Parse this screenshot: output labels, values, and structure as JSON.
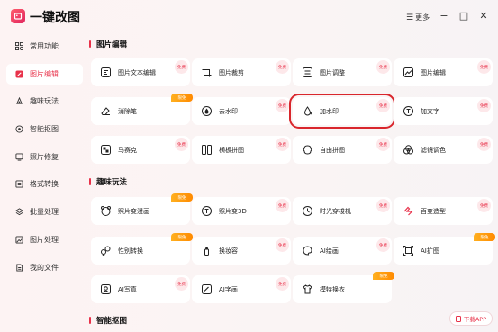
{
  "app": {
    "title": "一键改图",
    "more_label": "更多"
  },
  "window": {
    "minimize": "−",
    "maximize": "□",
    "close": "✕"
  },
  "colors": {
    "accent": "#e8324a",
    "highlight": "#d9262c",
    "vip": "#ff9a10"
  },
  "sidebar": {
    "items": [
      {
        "label": "常用功能",
        "icon": "grid-icon",
        "active": false
      },
      {
        "label": "图片编辑",
        "icon": "edit-image-icon",
        "active": true
      },
      {
        "label": "趣味玩法",
        "icon": "fun-icon",
        "active": false
      },
      {
        "label": "智能抠图",
        "icon": "cutout-icon",
        "active": false
      },
      {
        "label": "照片修复",
        "icon": "repair-icon",
        "active": false
      },
      {
        "label": "格式转换",
        "icon": "convert-icon",
        "active": false
      },
      {
        "label": "批量处理",
        "icon": "batch-icon",
        "active": false
      },
      {
        "label": "图片处理",
        "icon": "image-process-icon",
        "active": false
      },
      {
        "label": "我的文件",
        "icon": "file-icon",
        "active": false
      }
    ]
  },
  "badges": {
    "free": "免费",
    "vip": "限免"
  },
  "sections": [
    {
      "title": "图片编辑"
    },
    {
      "title": "趣味玩法"
    },
    {
      "title": "智能抠图"
    }
  ],
  "cards": [
    {
      "label": "图片文本编辑",
      "icon": "text-edit-icon",
      "badge": "free"
    },
    {
      "label": "图片裁剪",
      "icon": "crop-icon",
      "badge": "free"
    },
    {
      "label": "图片调整",
      "icon": "adjust-icon",
      "badge": "free"
    },
    {
      "label": "图片编辑",
      "icon": "image-edit-icon",
      "badge": "free"
    },
    {
      "label": "消除笔",
      "icon": "eraser-icon",
      "badge": "vip"
    },
    {
      "label": "去水印",
      "icon": "remove-watermark-icon",
      "badge": "free"
    },
    {
      "label": "加水印",
      "icon": "add-watermark-icon",
      "badge": "free"
    },
    {
      "label": "加文字",
      "icon": "add-text-icon",
      "badge": "free"
    },
    {
      "label": "马赛克",
      "icon": "mosaic-icon",
      "badge": "free"
    },
    {
      "label": "横板拼图",
      "icon": "horizontal-collage-icon",
      "badge": "free"
    },
    {
      "label": "自由拼图",
      "icon": "free-collage-icon",
      "badge": "free"
    },
    {
      "label": "滤镜调色",
      "icon": "filter-icon",
      "badge": "free"
    },
    {
      "label": "照片变漫画",
      "icon": "comic-icon",
      "badge": "vip"
    },
    {
      "label": "照片变3D",
      "icon": "3d-icon",
      "badge": "free"
    },
    {
      "label": "时光穿梭机",
      "icon": "time-machine-icon",
      "badge": "free"
    },
    {
      "label": "百变造型",
      "icon": "style-icon",
      "badge": "free"
    },
    {
      "label": "性别转换",
      "icon": "gender-icon",
      "badge": "vip"
    },
    {
      "label": "换妆容",
      "icon": "makeup-icon",
      "badge": "free"
    },
    {
      "label": "AI绘画",
      "icon": "ai-paint-icon",
      "badge": "free"
    },
    {
      "label": "AI扩图",
      "icon": "ai-expand-icon",
      "badge": "vip"
    },
    {
      "label": "AI写真",
      "icon": "ai-portrait-icon",
      "badge": "free"
    },
    {
      "label": "AI字画",
      "icon": "ai-calligraphy-icon",
      "badge": "free"
    },
    {
      "label": "模特换衣",
      "icon": "outfit-icon",
      "badge": "vip"
    }
  ],
  "download": {
    "label": "下载APP"
  }
}
